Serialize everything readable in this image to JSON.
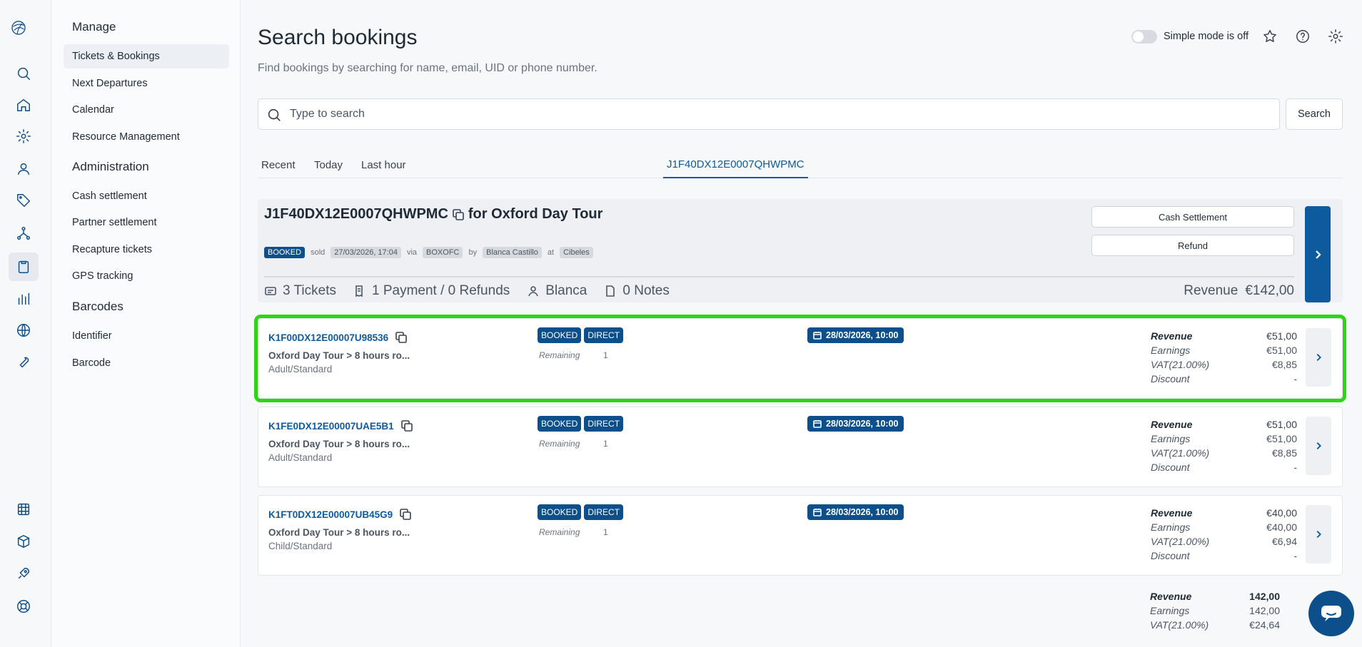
{
  "colors": {
    "accent": "#0d4f8b",
    "link": "#0d5a9e",
    "highlight": "#2cd615"
  },
  "rail": {
    "icons": [
      "app-logo",
      "search-icon",
      "home-icon",
      "settings-icon",
      "user-location-icon",
      "tag-icon",
      "network-icon",
      "clipboard-icon",
      "bar-chart-icon",
      "globe-icon",
      "wrench-icon",
      "calendar-grid-icon",
      "box-icon",
      "rocket-icon",
      "lifebuoy-icon"
    ]
  },
  "nav": {
    "sections": [
      {
        "title": "Manage",
        "items": [
          "Tickets & Bookings",
          "Next Departures",
          "Calendar",
          "Resource Management"
        ]
      },
      {
        "title": "Administration",
        "items": [
          "Cash settlement",
          "Partner settlement",
          "Recapture tickets",
          "GPS tracking"
        ]
      },
      {
        "title": "Barcodes",
        "items": [
          "Identifier",
          "Barcode"
        ]
      }
    ]
  },
  "header": {
    "title": "Search bookings",
    "subtitle": "Find bookings by searching for name, email, UID or phone number.",
    "simple_mode_label": "Simple mode is off"
  },
  "search": {
    "placeholder": "Type to search",
    "value": "",
    "button": "Search"
  },
  "tabs": [
    "Recent",
    "Today",
    "Last hour",
    "J1F40DX12E0007QHWPMC"
  ],
  "booking": {
    "uid": "J1F40DX12E0007QHWPMC",
    "for_text": "for Oxford Day Tour",
    "status": "BOOKED",
    "sold_label": "sold",
    "sold_date": "27/03/2026, 17:04",
    "via_label": "via",
    "via": "BOXOFC",
    "by_label": "by",
    "by": "Blanca Castillo",
    "at_label": "at",
    "at": "Cibeles",
    "cash_settlement_btn": "Cash Settlement",
    "refund_btn": "Refund",
    "stats": {
      "tickets": "3 Tickets",
      "payments": "1 Payment / 0 Refunds",
      "user": "Blanca",
      "notes": "0 Notes"
    },
    "revenue_label": "Revenue",
    "revenue_value": "€142,00"
  },
  "tickets": [
    {
      "id": "K1F00DX12E00007U98536",
      "product": "Oxford Day Tour > 8 hours ro...",
      "variant": "Adult/Standard",
      "badges": [
        "BOOKED",
        "DIRECT"
      ],
      "remaining_label": "Remaining",
      "remaining": "1",
      "date": "28/03/2026, 10:00",
      "revenue_label": "Revenue",
      "revenue": "€51,00",
      "earnings_label": "Earnings",
      "earnings": "€51,00",
      "vat_label": "VAT(21.00%)",
      "vat": "€8,85",
      "discount_label": "Discount",
      "discount": "-"
    },
    {
      "id": "K1FE0DX12E00007UAE5B1",
      "product": "Oxford Day Tour > 8 hours ro...",
      "variant": "Adult/Standard",
      "badges": [
        "BOOKED",
        "DIRECT"
      ],
      "remaining_label": "Remaining",
      "remaining": "1",
      "date": "28/03/2026, 10:00",
      "revenue_label": "Revenue",
      "revenue": "€51,00",
      "earnings_label": "Earnings",
      "earnings": "€51,00",
      "vat_label": "VAT(21.00%)",
      "vat": "€8,85",
      "discount_label": "Discount",
      "discount": "-"
    },
    {
      "id": "K1FT0DX12E00007UB45G9",
      "product": "Oxford Day Tour > 8 hours ro...",
      "variant": "Child/Standard",
      "badges": [
        "BOOKED",
        "DIRECT"
      ],
      "remaining_label": "Remaining",
      "remaining": "1",
      "date": "28/03/2026, 10:00",
      "revenue_label": "Revenue",
      "revenue": "€40,00",
      "earnings_label": "Earnings",
      "earnings": "€40,00",
      "vat_label": "VAT(21.00%)",
      "vat": "€6,94",
      "discount_label": "Discount",
      "discount": "-"
    }
  ],
  "totals": {
    "revenue_label": "Revenue",
    "revenue": "142,00",
    "earnings_label": "Earnings",
    "earnings": "142,00",
    "vat_label": "VAT(21.00%)",
    "vat": "€24,64"
  }
}
